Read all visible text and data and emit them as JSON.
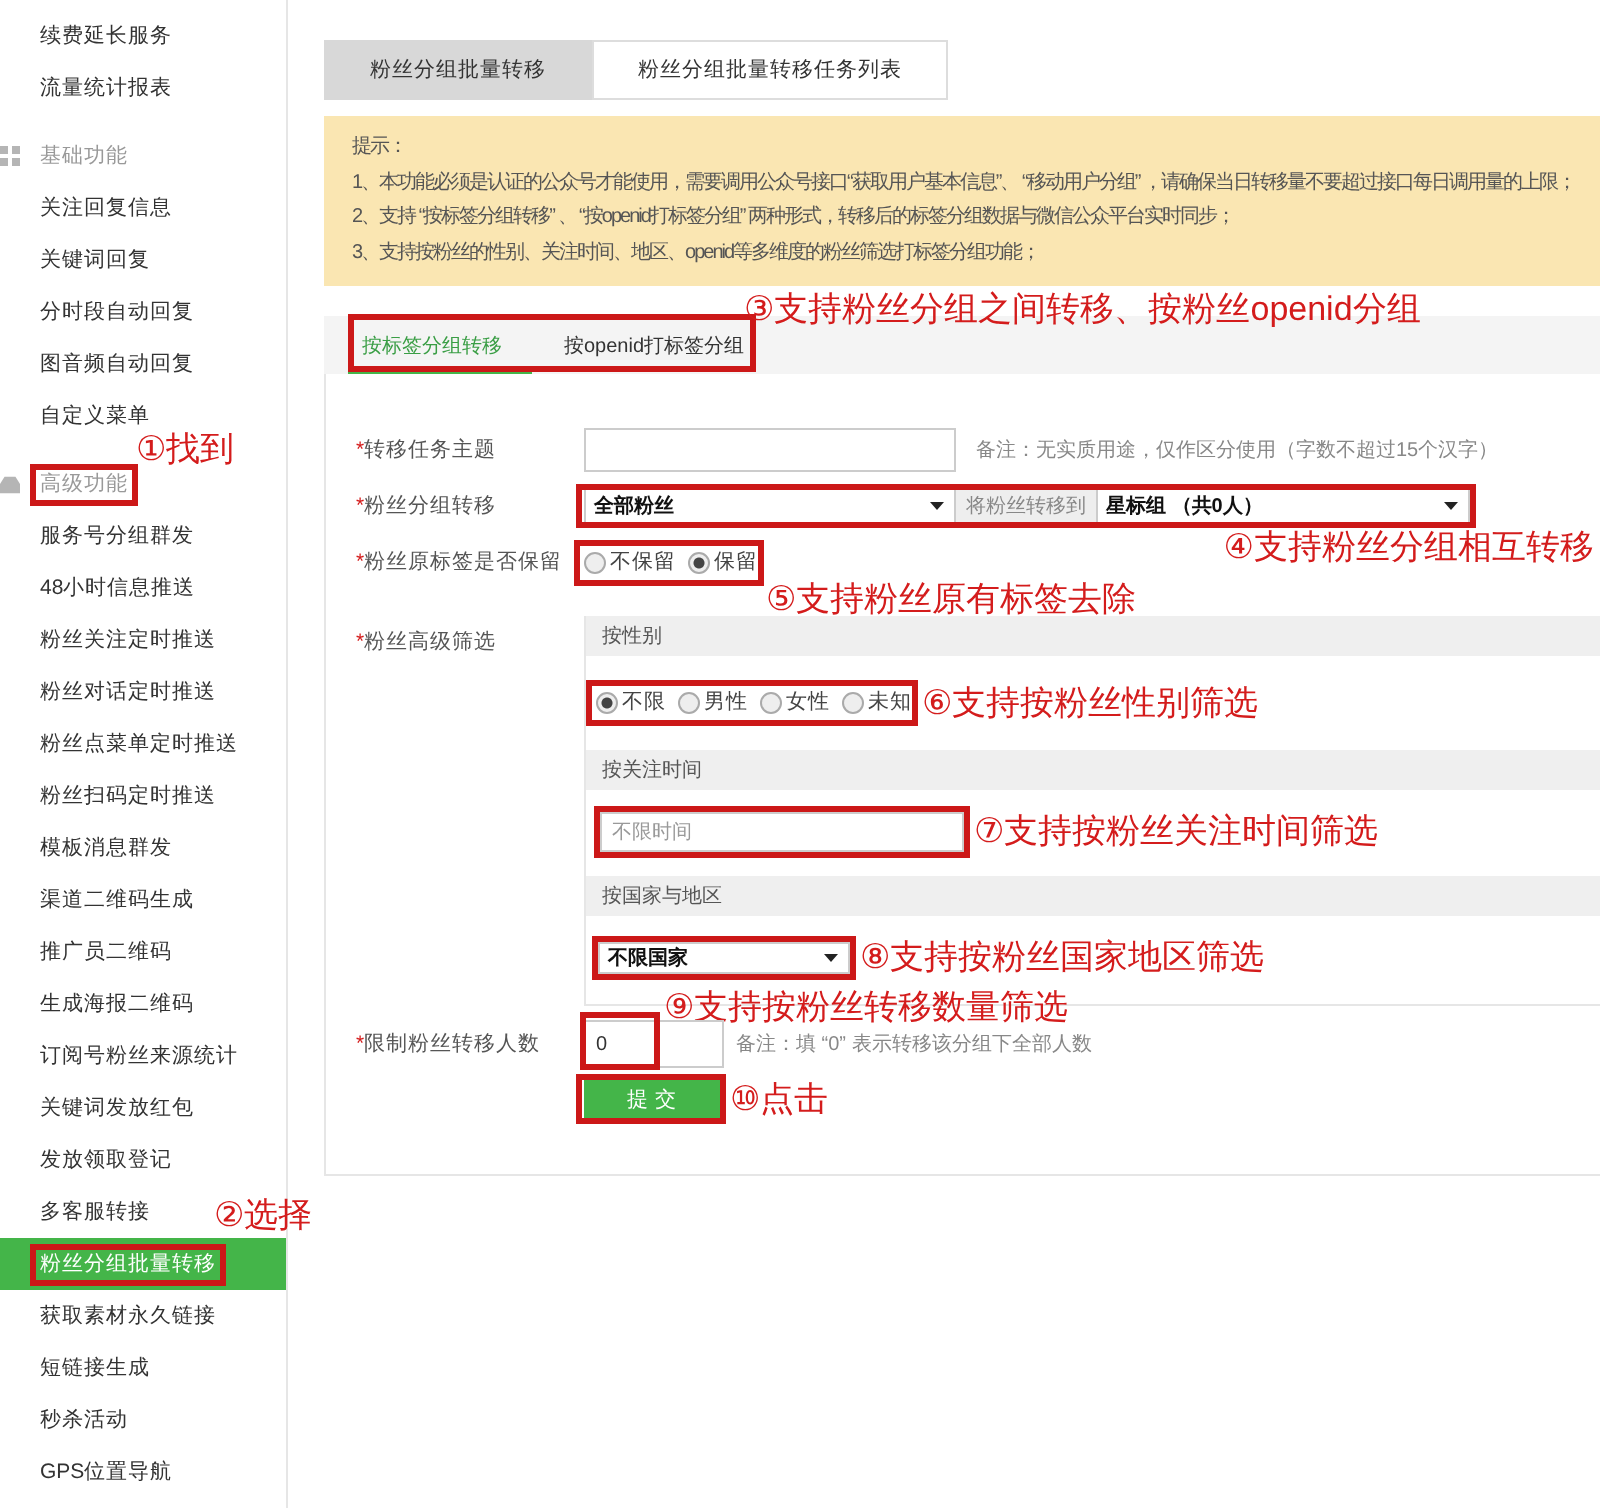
{
  "sidebar": {
    "items": [
      {
        "kind": "link",
        "label": "续费延长服务",
        "selected": false,
        "highlighted": false
      },
      {
        "kind": "link",
        "label": "流量统计报表",
        "selected": false,
        "highlighted": false
      },
      {
        "kind": "section",
        "label": "基础功能",
        "selected": false,
        "highlighted": false
      },
      {
        "kind": "link",
        "label": "关注回复信息",
        "selected": false,
        "highlighted": false
      },
      {
        "kind": "link",
        "label": "关键词回复",
        "selected": false,
        "highlighted": false
      },
      {
        "kind": "link",
        "label": "分时段自动回复",
        "selected": false,
        "highlighted": false
      },
      {
        "kind": "link",
        "label": "图音频自动回复",
        "selected": false,
        "highlighted": false
      },
      {
        "kind": "link",
        "label": "自定义菜单",
        "selected": false,
        "highlighted": false
      },
      {
        "kind": "section",
        "label": "高级功能",
        "selected": false,
        "highlighted": true,
        "annotation": "①找到"
      },
      {
        "kind": "link",
        "label": "服务号分组群发",
        "selected": false,
        "highlighted": false
      },
      {
        "kind": "link",
        "label": "48小时信息推送",
        "selected": false,
        "highlighted": false
      },
      {
        "kind": "link",
        "label": "粉丝关注定时推送",
        "selected": false,
        "highlighted": false
      },
      {
        "kind": "link",
        "label": "粉丝对话定时推送",
        "selected": false,
        "highlighted": false
      },
      {
        "kind": "link",
        "label": "粉丝点菜单定时推送",
        "selected": false,
        "highlighted": false
      },
      {
        "kind": "link",
        "label": "粉丝扫码定时推送",
        "selected": false,
        "highlighted": false
      },
      {
        "kind": "link",
        "label": "模板消息群发",
        "selected": false,
        "highlighted": false
      },
      {
        "kind": "link",
        "label": "渠道二维码生成",
        "selected": false,
        "highlighted": false
      },
      {
        "kind": "link",
        "label": "推广员二维码",
        "selected": false,
        "highlighted": false
      },
      {
        "kind": "link",
        "label": "生成海报二维码",
        "selected": false,
        "highlighted": false
      },
      {
        "kind": "link",
        "label": "订阅号粉丝来源统计",
        "selected": false,
        "highlighted": false
      },
      {
        "kind": "link",
        "label": "关键词发放红包",
        "selected": false,
        "highlighted": false
      },
      {
        "kind": "link",
        "label": "发放领取登记",
        "selected": false,
        "highlighted": false
      },
      {
        "kind": "link",
        "label": "多客服转接",
        "selected": false,
        "highlighted": false
      },
      {
        "kind": "link",
        "label": "粉丝分组批量转移",
        "selected": true,
        "highlighted": true,
        "annotation": "②选择"
      },
      {
        "kind": "link",
        "label": "获取素材永久链接",
        "selected": false,
        "highlighted": false
      },
      {
        "kind": "link",
        "label": "短链接生成",
        "selected": false,
        "highlighted": false
      },
      {
        "kind": "link",
        "label": "秒杀活动",
        "selected": false,
        "highlighted": false
      },
      {
        "kind": "link",
        "label": "GPS位置导航",
        "selected": false,
        "highlighted": false
      }
    ]
  },
  "page_tabs": [
    {
      "label": "粉丝分组批量转移",
      "selected": true
    },
    {
      "label": "粉丝分组批量转移任务列表",
      "selected": false
    }
  ],
  "notice": {
    "title": "提示：",
    "lines": [
      "1、本功能必须是认证的公众号才能使用，需要调用公众号接口“获取用户基本信息”、 “移动用户分组” ，请确保当日转移量不要超过接口每日调用量的上限；",
      "2、支持 “按标签分组转移” 、 “按openid打标签分组” 两种形式，转移后的标签分组数据与微信公众平台实时同步；",
      "3、支持按粉丝的性别、关注时间、地区、openid等多维度的粉丝筛选打标签分组功能；"
    ]
  },
  "mode_tabs": {
    "highlighted": true,
    "annotation": "③支持粉丝分组之间转移、按粉丝openid分组",
    "tabs": [
      {
        "label": "按标签分组转移",
        "selected": true
      },
      {
        "label": "按openid打标签分组",
        "selected": false
      }
    ]
  },
  "form": {
    "rows": [
      {
        "kind": "text",
        "mark": "*",
        "label": "转移任务主题",
        "note": "备注：无实质用途，仅作区分使用（字数不超过15个汉字）",
        "highlighted": false
      },
      {
        "kind": "transfer",
        "mark": "*",
        "label": "粉丝分组转移",
        "from": "全部粉丝",
        "to_label": "将粉丝转移到",
        "to": "星标组 （共0人）",
        "highlighted": true,
        "annotation": "④支持粉丝分组相互转移"
      },
      {
        "kind": "radio",
        "mark": "*",
        "label": "粉丝原标签是否保留",
        "options": [
          {
            "label": "不保留",
            "selected": false
          },
          {
            "label": "保留",
            "selected": true
          }
        ],
        "highlighted": true,
        "annotation": "⑤支持粉丝原有标签去除"
      },
      {
        "kind": "filters",
        "mark": "*",
        "label": "粉丝高级筛选",
        "highlighted": false,
        "sections": [
          {
            "kind": "radio",
            "title": "按性别",
            "options": [
              {
                "label": "不限",
                "selected": true
              },
              {
                "label": "男性",
                "selected": false
              },
              {
                "label": "女性",
                "selected": false
              },
              {
                "label": "未知",
                "selected": false
              }
            ],
            "highlighted": true,
            "annotation": "⑥支持按粉丝性别筛选"
          },
          {
            "kind": "input",
            "title": "按关注时间",
            "placeholder": "不限时间",
            "highlighted": true,
            "annotation": "⑦支持按粉丝关注时间筛选"
          },
          {
            "kind": "select",
            "title": "按国家与地区",
            "value": "不限国家",
            "highlighted": true,
            "annotation": "⑧支持按粉丝国家地区筛选"
          }
        ]
      },
      {
        "kind": "number",
        "mark": "*",
        "label": "限制粉丝转移人数",
        "value": "0",
        "note": "备注：填 “0” 表示转移该分组下全部人数",
        "highlighted": true,
        "annotation": "⑨支持按粉丝转移数量筛选"
      }
    ],
    "submit": {
      "label": "提 交",
      "highlighted": true,
      "annotation": "⑩点击"
    }
  }
}
